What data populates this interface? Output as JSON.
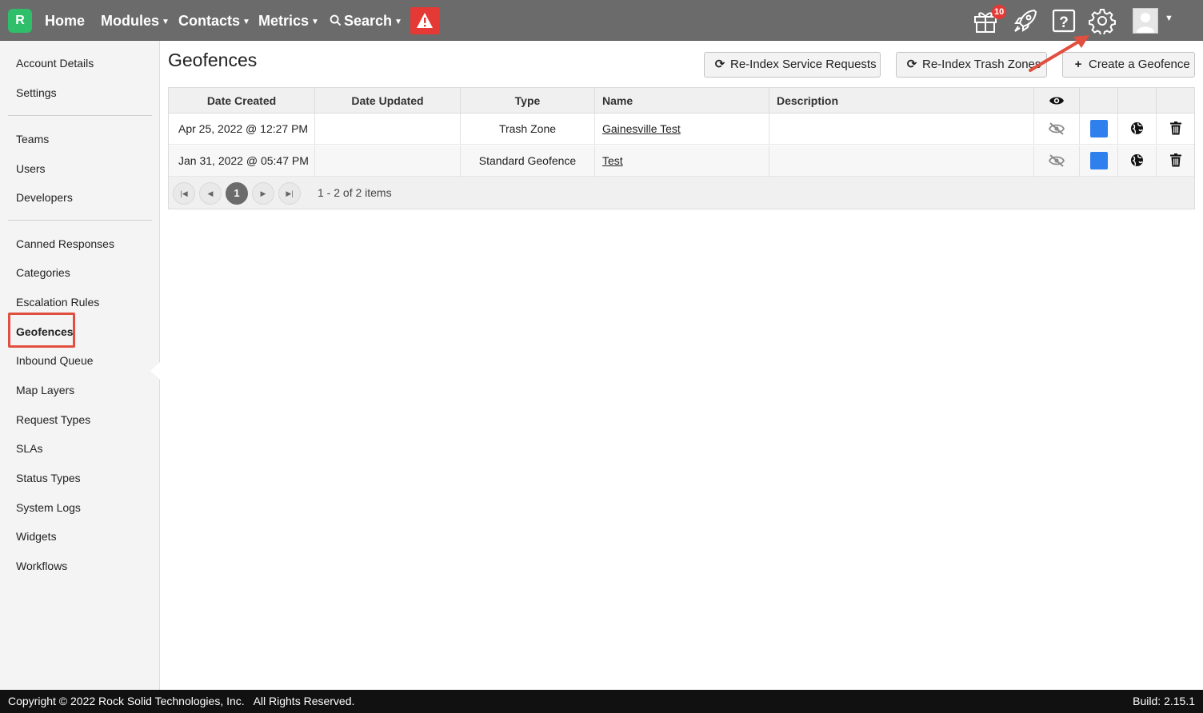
{
  "nav": {
    "logo_text": "R",
    "items": [
      {
        "label": "Home",
        "dropdown": false
      },
      {
        "label": "Modules",
        "dropdown": true
      },
      {
        "label": "Contacts",
        "dropdown": true
      },
      {
        "label": "Metrics",
        "dropdown": true
      },
      {
        "label": "Search",
        "dropdown": true
      }
    ],
    "notification_count": "10",
    "icons": [
      "alert-icon",
      "gift-icon",
      "rocket-icon",
      "help-icon",
      "gear-icon",
      "user-avatar-icon"
    ],
    "accent_color": "#2fbf6a",
    "alert_color": "#e53935"
  },
  "sidebar": {
    "groups": [
      [
        "Account Details",
        "Settings"
      ],
      [
        "Teams",
        "Users",
        "Developers"
      ],
      [
        "Canned Responses",
        "Categories",
        "Escalation Rules",
        "Geofences",
        "Inbound Queue",
        "Map Layers",
        "Request Types",
        "SLAs",
        "Status Types",
        "System Logs",
        "Widgets",
        "Workflows"
      ]
    ],
    "active": "Geofences"
  },
  "page": {
    "title": "Geofences",
    "buttons": {
      "reindex_service": "Re-Index Service Requests",
      "reindex_trash": "Re-Index Trash Zones",
      "create": "Create a Geofence"
    }
  },
  "table": {
    "columns": [
      "Date Created",
      "Date Updated",
      "Type",
      "Name",
      "Description"
    ],
    "rows": [
      {
        "date_created": "Apr 25, 2022 @ 12:27 PM",
        "date_updated": "",
        "type": "Trash Zone",
        "name": "Gainesville Test",
        "description": "",
        "color": "#2f80ed"
      },
      {
        "date_created": "Jan 31, 2022 @ 05:47 PM",
        "date_updated": "",
        "type": "Standard Geofence",
        "name": "Test",
        "description": "",
        "color": "#2f80ed"
      }
    ],
    "pager": {
      "current_page": "1",
      "info": "1 - 2 of 2 items"
    }
  },
  "footer": {
    "copyright": "Copyright © 2022 Rock Solid Technologies, Inc.   All Rights Reserved.",
    "build": "Build: 2.15.1"
  }
}
